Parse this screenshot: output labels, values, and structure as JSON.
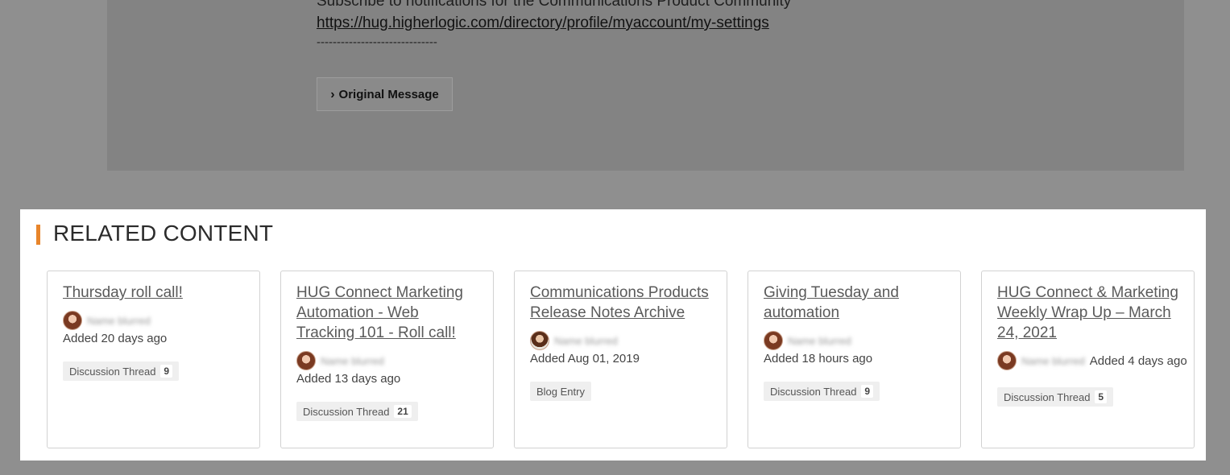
{
  "message": {
    "subscribe_text": "Subscribe to notifications for the Communications Product Community",
    "settings_link": "https://hug.higherlogic.com/directory/profile/myaccount/my-settings",
    "separator": "------------------------------",
    "original_message_button": "Original Message"
  },
  "related": {
    "heading": "RELATED CONTENT",
    "accent_color": "#e8852b",
    "cards": [
      {
        "title": "Thursday roll call!",
        "author": "Name blurred",
        "added": "Added 20 days ago",
        "badge": "Discussion Thread",
        "count": "9"
      },
      {
        "title": "HUG Connect Marketing Automation - Web Tracking 101 - Roll call!",
        "author": "Name blurred",
        "added": "Added 13 days ago",
        "badge": "Discussion Thread",
        "count": "21"
      },
      {
        "title": "Communications Products Release Notes Archive",
        "author": "Name blurred",
        "added": "Added Aug 01, 2019",
        "badge": "Blog Entry",
        "count": ""
      },
      {
        "title": "Giving Tuesday and automation",
        "author": "Name blurred",
        "added": "Added 18 hours ago",
        "badge": "Discussion Thread",
        "count": "9"
      },
      {
        "title": "HUG Connect & Marketing Weekly Wrap Up – March 24, 2021",
        "author": "Name blurred",
        "added": "Added 4 days ago",
        "badge": "Discussion Thread",
        "count": "5"
      }
    ]
  }
}
